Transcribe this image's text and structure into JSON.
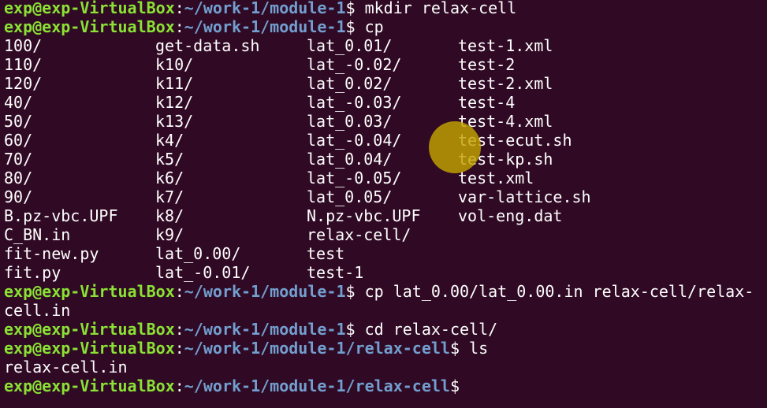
{
  "terminal": {
    "colors": {
      "background": "#300a24",
      "user_host": "#8ae234",
      "path": "#729fcf",
      "text": "#ffffff",
      "cursor_highlight": "#c4a400"
    },
    "top_partial_text": "",
    "prompt_user_host": "exp@exp-VirtualBox",
    "lines": [
      {
        "path": "~/work-1/module-1",
        "sep": ":",
        "end": "$ ",
        "command": "mkdir relax-cell"
      },
      {
        "path": "~/work-1/module-1",
        "sep": ":",
        "end": "$ ",
        "command": "cp"
      }
    ],
    "ls_grid": [
      [
        "100/",
        "get-data.sh",
        "lat_0.01/",
        "test-1.xml"
      ],
      [
        "110/",
        "k10/",
        "lat_-0.02/",
        "test-2"
      ],
      [
        "120/",
        "k11/",
        "lat_0.02/",
        "test-2.xml"
      ],
      [
        "40/",
        "k12/",
        "lat_-0.03/",
        "test-4"
      ],
      [
        "50/",
        "k13/",
        "lat_0.03/",
        "test-4.xml"
      ],
      [
        "60/",
        "k4/",
        "lat_-0.04/",
        "test-ecut.sh"
      ],
      [
        "70/",
        "k5/",
        "lat_0.04/",
        "test-kp.sh"
      ],
      [
        "80/",
        "k6/",
        "lat_-0.05/",
        "test.xml"
      ],
      [
        "90/",
        "k7/",
        "lat_0.05/",
        "var-lattice.sh"
      ],
      [
        "B.pz-vbc.UPF",
        "k8/",
        "N.pz-vbc.UPF",
        "vol-eng.dat"
      ],
      [
        "C_BN.in",
        "k9/",
        "relax-cell/",
        ""
      ],
      [
        "fit-new.py",
        "lat_0.00/",
        "test",
        ""
      ],
      [
        "fit.py",
        "lat_-0.01/",
        "test-1",
        ""
      ]
    ],
    "after": {
      "cp_line": {
        "path": "~/work-1/module-1",
        "sep": ":",
        "end": "$ ",
        "command": "cp lat_0.00/lat_0.00.in relax-cell/relax-"
      },
      "cp_wrap": "cell.in",
      "cd_line": {
        "path": "~/work-1/module-1",
        "sep": ":",
        "end": "$ ",
        "command": "cd relax-cell/"
      },
      "ls_line": {
        "path": "~/work-1/module-1/relax-cell",
        "sep": ":",
        "end": "$ ",
        "command": "ls"
      },
      "ls_output": "relax-cell.in",
      "final_prompt": {
        "path": "~/work-1/module-1/relax-cell",
        "sep": ":",
        "end": "$",
        "command": ""
      }
    }
  }
}
